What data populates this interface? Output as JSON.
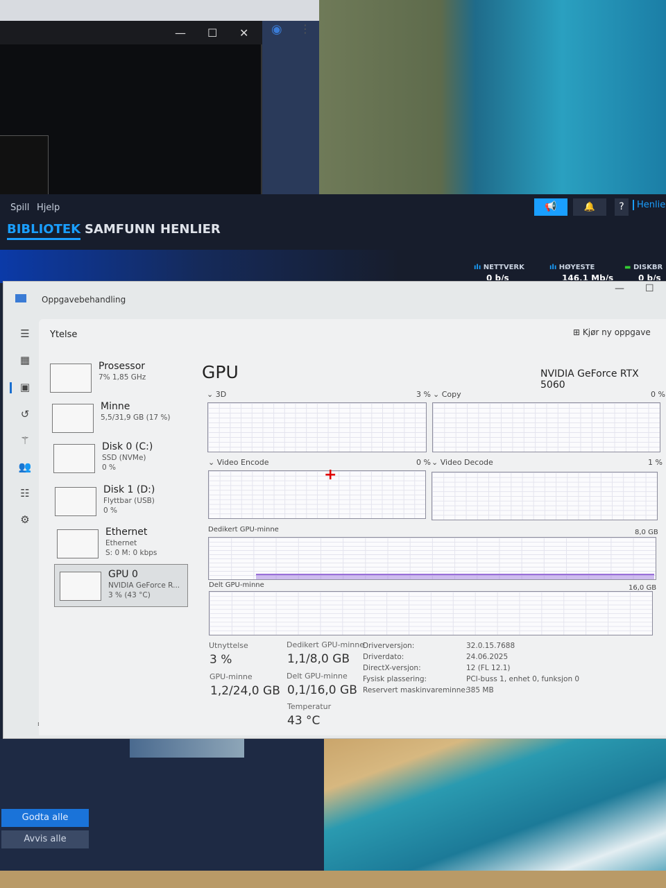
{
  "steam": {
    "menu": [
      "Spill",
      "Hjelp"
    ],
    "tabs": [
      "BIBLIOTEK",
      "SAMFUNN",
      "HENLIER"
    ],
    "username": "Henlier",
    "downloads": [
      {
        "label": "NETTVERK",
        "value": "0 b/s"
      },
      {
        "label": "HØYESTE",
        "value": "146,1 Mb/s"
      },
      {
        "label": "DISKBR",
        "value": "0 b/s"
      }
    ],
    "accept_all": "Godta alle",
    "reject_all": "Avvis alle"
  },
  "taskmanager": {
    "title": "Oppgavebehandling",
    "page": "Ytelse",
    "new_task": "Kjør ny oppgave",
    "sidebar": [
      {
        "name": "Prosessor",
        "line1": "7% 1,85 GHz",
        "line2": ""
      },
      {
        "name": "Minne",
        "line1": "5,5/31,9 GB (17 %)",
        "line2": ""
      },
      {
        "name": "Disk 0 (C:)",
        "line1": "SSD (NVMe)",
        "line2": "0 %"
      },
      {
        "name": "Disk 1 (D:)",
        "line1": "Flyttbar (USB)",
        "line2": "0 %"
      },
      {
        "name": "Ethernet",
        "line1": "Ethernet",
        "line2": "S: 0 M: 0 kbps"
      },
      {
        "name": "GPU 0",
        "line1": "NVIDIA GeForce R...",
        "line2": "3 % (43 °C)"
      }
    ],
    "gpu": {
      "heading": "GPU",
      "model": "NVIDIA GeForce RTX 5060",
      "engines": [
        {
          "name": "3D",
          "value": "3 %"
        },
        {
          "name": "Copy",
          "value": "0 %"
        },
        {
          "name": "Video Encode",
          "value": "0 %"
        },
        {
          "name": "Video Decode",
          "value": "1 %"
        }
      ],
      "dedicated_label": "Dedikert GPU-minne",
      "dedicated_max": "8,0 GB",
      "shared_label": "Delt GPU-minne",
      "shared_max": "16,0 GB",
      "stats": {
        "util_label": "Utnyttelse",
        "util": "3 %",
        "gpumem_label": "GPU-minne",
        "gpumem": "1,2/24,0 GB",
        "ded_label": "Dedikert GPU-minne",
        "ded": "1,1/8,0 GB",
        "shared_label": "Delt GPU-minne",
        "shared": "0,1/16,0 GB",
        "temp_label": "Temperatur",
        "temp": "43 °C"
      },
      "info": [
        {
          "k": "Driverversjon:",
          "v": "32.0.15.7688"
        },
        {
          "k": "Driverdato:",
          "v": "24.06.2025"
        },
        {
          "k": "DirectX-versjon:",
          "v": "12 (FL 12.1)"
        },
        {
          "k": "Fysisk plassering:",
          "v": "PCI-buss 1, enhet 0, funksjon 0"
        },
        {
          "k": "Reservert maskinvareminne:",
          "v": "385 MB"
        }
      ]
    }
  }
}
